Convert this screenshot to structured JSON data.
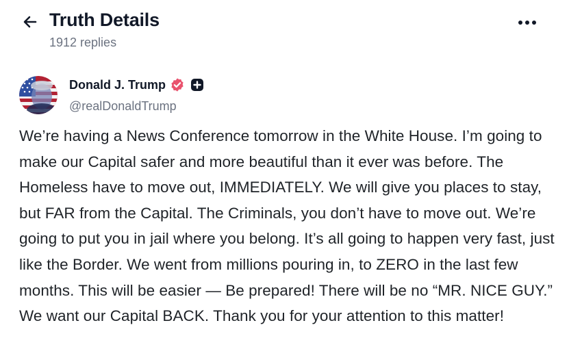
{
  "header": {
    "title": "Truth Details",
    "replies": "1912 replies"
  },
  "post": {
    "author_name": "Donald J. Trump",
    "handle": "@realDonaldTrump",
    "text": "We’re having a News Conference tomorrow in the White House. I’m going to make our Capital safer and more beautiful than it ever was before. The Homeless have to move out, IMMEDIATELY. We will give you places to stay, but FAR from the Capital. The Criminals, you don’t have to move out. We’re going to put you in jail where you belong. It’s all going to happen very fast, just like the Border. We went from millions pouring in, to ZERO in the last few months. This will be easier — Be prepared! There will be no “MR. NICE GUY.” We want our Capital BACK. Thank you for your attention to this matter!"
  },
  "icons": {
    "back": "arrow-left-icon",
    "more": "more-horizontal-icon",
    "verified": "verified-badge-icon",
    "plus": "plus-badge-icon"
  },
  "colors": {
    "verified_badge": "#e9526d",
    "text_primary": "#111827",
    "text_secondary": "#6b7280"
  }
}
